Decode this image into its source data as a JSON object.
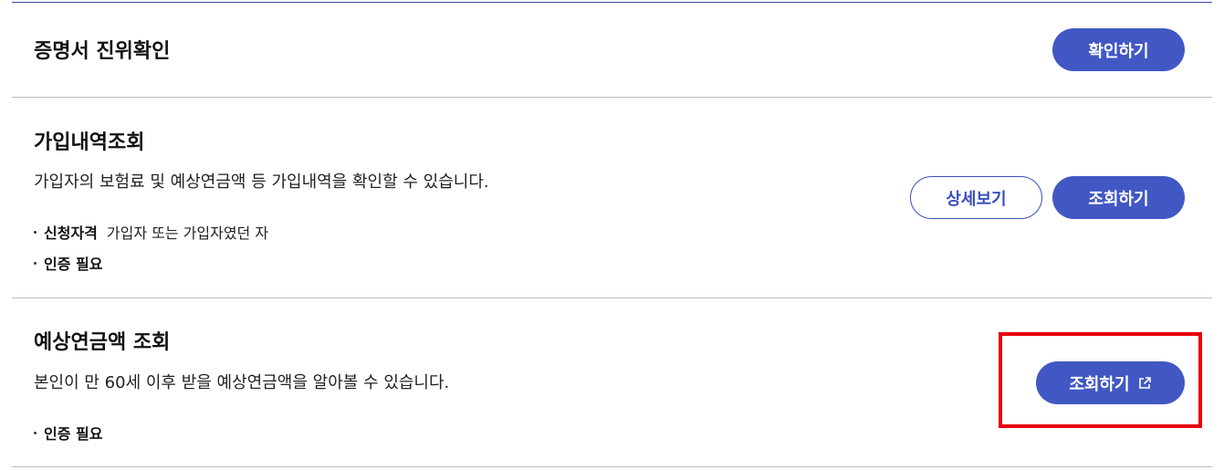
{
  "section_verify": {
    "title": "증명서 진위확인",
    "confirm_button": "확인하기"
  },
  "section_subscription": {
    "title": "가입내역조회",
    "description": "가입자의 보험료 및 예상연금액 등 가입내역을 확인할 수 있습니다.",
    "eligibility_label": "신청자격",
    "eligibility_value": "가입자 또는 가입자였던 자",
    "auth_required": "인증 필요",
    "detail_button": "상세보기",
    "inquiry_button": "조회하기"
  },
  "section_pension": {
    "title": "예상연금액 조회",
    "description": "본인이 만 60세 이후 받을 예상연금액을 알아볼 수 있습니다.",
    "auth_required": "인증 필요",
    "inquiry_button": "조회하기",
    "inquiry_icon": "external-link-icon"
  },
  "colors": {
    "primary": "#4158c4",
    "highlight": "#e8000b",
    "top_border": "#3a4ba8"
  }
}
